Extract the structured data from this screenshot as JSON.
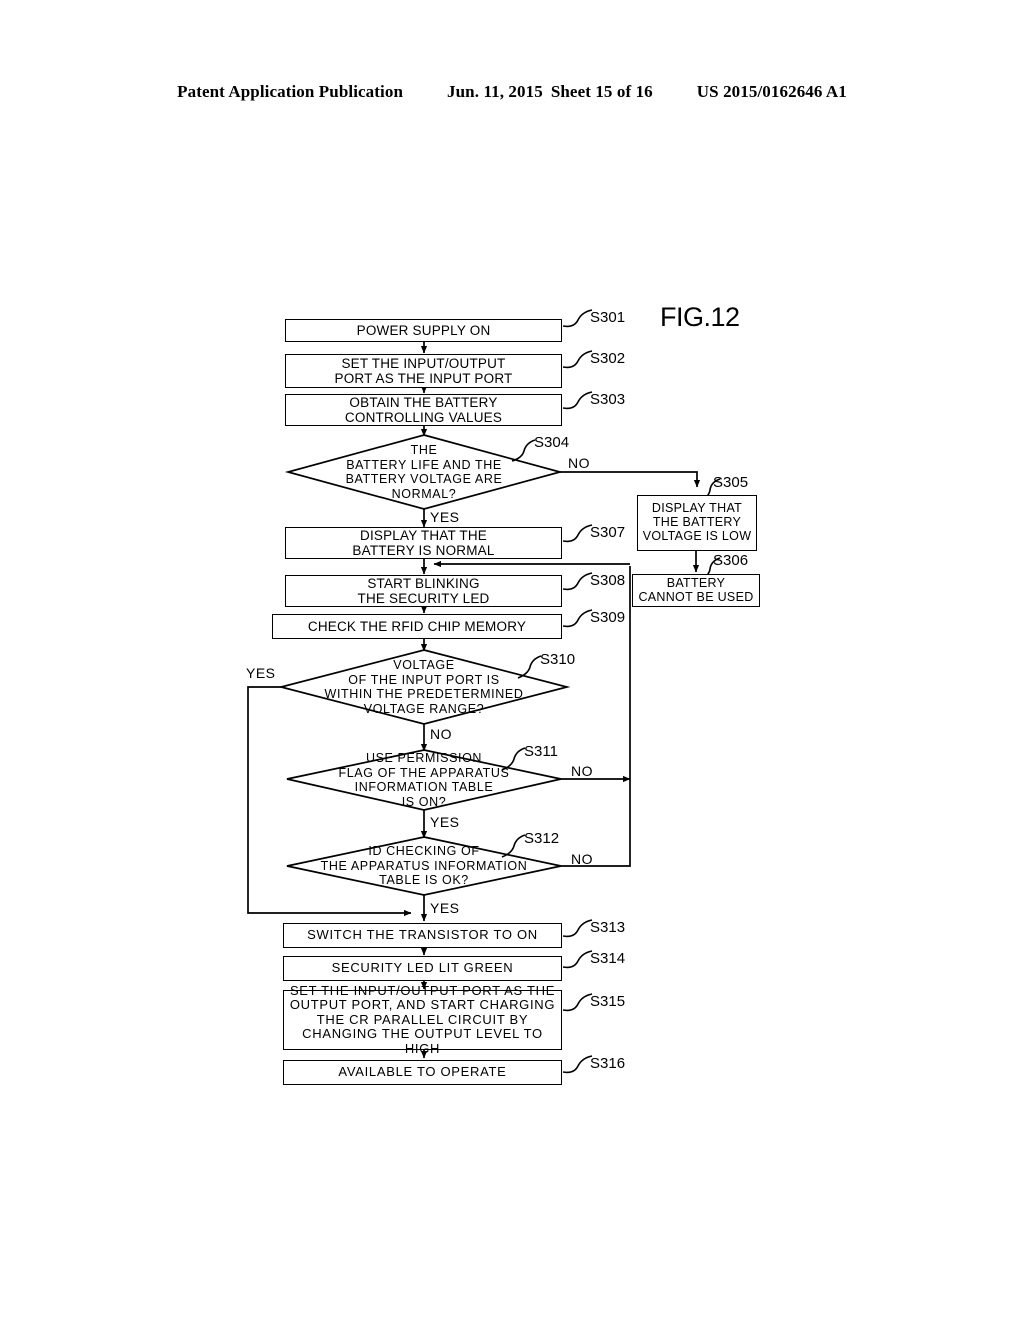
{
  "header": {
    "publication": "Patent Application Publication",
    "date": "Jun. 11, 2015",
    "sheet": "Sheet 15 of 16",
    "number": "US 2015/0162646 A1"
  },
  "figure": {
    "label": "FIG.12"
  },
  "flowchart": {
    "nodes": [
      {
        "id": "S301",
        "type": "process",
        "text": "POWER SUPPLY ON"
      },
      {
        "id": "S302",
        "type": "process",
        "text": "SET THE INPUT/OUTPUT\nPORT AS THE INPUT PORT"
      },
      {
        "id": "S303",
        "type": "process",
        "text": "OBTAIN THE BATTERY\nCONTROLLING VALUES"
      },
      {
        "id": "S304",
        "type": "decision",
        "text": "THE\nBATTERY LIFE AND THE\nBATTERY VOLTAGE ARE\nNORMAL?"
      },
      {
        "id": "S305",
        "type": "process",
        "text": "DISPLAY THAT\nTHE BATTERY\nVOLTAGE IS LOW"
      },
      {
        "id": "S306",
        "type": "process",
        "text": "BATTERY\nCANNOT BE USED"
      },
      {
        "id": "S307",
        "type": "process",
        "text": "DISPLAY THAT THE\nBATTERY IS NORMAL"
      },
      {
        "id": "S308",
        "type": "process",
        "text": "START BLINKING\nTHE SECURITY LED"
      },
      {
        "id": "S309",
        "type": "process",
        "text": "CHECK THE RFID CHIP MEMORY"
      },
      {
        "id": "S310",
        "type": "decision",
        "text": "VOLTAGE\nOF THE INPUT PORT IS\nWITHIN THE PREDETERMINED\nVOLTAGE RANGE?"
      },
      {
        "id": "S311",
        "type": "decision",
        "text": "USE PERMISSION\nFLAG OF THE APPARATUS\nINFORMATION TABLE\nIS ON?"
      },
      {
        "id": "S312",
        "type": "decision",
        "text": "ID CHECKING OF\nTHE APPARATUS INFORMATION\nTABLE IS OK?"
      },
      {
        "id": "S313",
        "type": "process",
        "text": "SWITCH THE TRANSISTOR TO ON"
      },
      {
        "id": "S314",
        "type": "process",
        "text": "SECURITY LED LIT GREEN"
      },
      {
        "id": "S315",
        "type": "process",
        "text": "SET THE INPUT/OUTPUT PORT AS THE\nOUTPUT PORT, AND START CHARGING\nTHE CR PARALLEL CIRCUIT BY\nCHANGING THE OUTPUT LEVEL TO HIGH"
      },
      {
        "id": "S316",
        "type": "process",
        "text": "AVAILABLE TO OPERATE"
      }
    ],
    "step_tags": {
      "s301": "S301",
      "s302": "S302",
      "s303": "S303",
      "s304": "S304",
      "s305": "S305",
      "s306": "S306",
      "s307": "S307",
      "s308": "S308",
      "s309": "S309",
      "s310": "S310",
      "s311": "S311",
      "s312": "S312",
      "s313": "S313",
      "s314": "S314",
      "s315": "S315",
      "s316": "S316"
    },
    "edge_labels": {
      "s304_no": "NO",
      "s304_yes": "YES",
      "s310_yes": "YES",
      "s310_no": "NO",
      "s311_no": "NO",
      "s311_yes": "YES",
      "s312_no": "NO",
      "s312_yes": "YES"
    },
    "colors": {
      "line": "#000000",
      "background": "#ffffff"
    }
  }
}
